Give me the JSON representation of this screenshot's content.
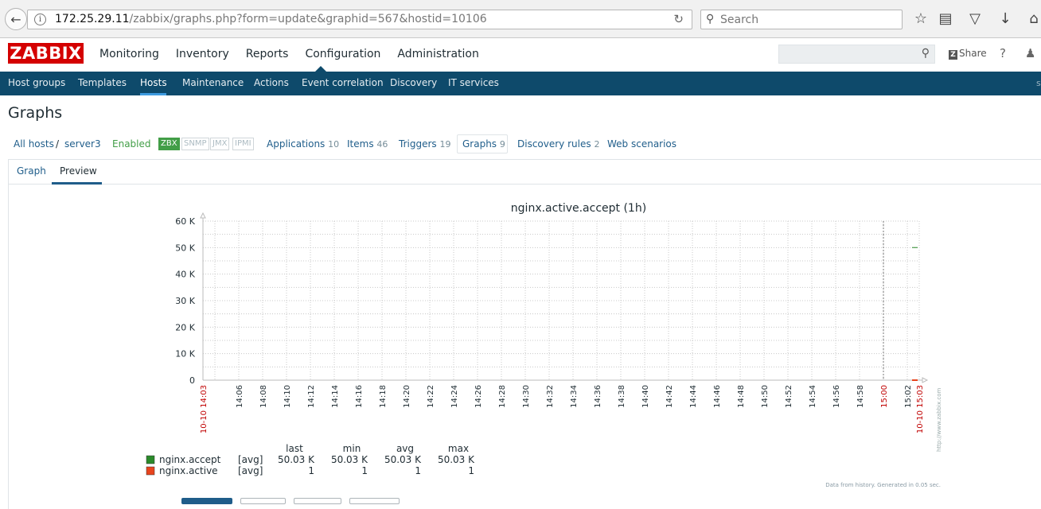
{
  "browser": {
    "url_host": "172.25.29.11",
    "url_path": "/zabbix/graphs.php?form=update&graphid=567&hostid=10106",
    "search_placeholder": "Search"
  },
  "header": {
    "logo": "ZABBIX",
    "menu": [
      "Monitoring",
      "Inventory",
      "Reports",
      "Configuration",
      "Administration"
    ],
    "active_menu": "Configuration",
    "share_label": "Share",
    "help_label": "?"
  },
  "submenu": {
    "items": [
      "Host groups",
      "Templates",
      "Hosts",
      "Maintenance",
      "Actions",
      "Event correlation",
      "Discovery",
      "IT services"
    ],
    "active": "Hosts",
    "edge_text": "s"
  },
  "page": {
    "title": "Graphs"
  },
  "breadcrumbs": {
    "all_hosts": "All hosts",
    "separator": "/",
    "host": "server3",
    "status": "Enabled",
    "interfaces": [
      "ZBX",
      "SNMP",
      "JMX",
      "IPMI"
    ],
    "applications": {
      "label": "Applications",
      "count": "10"
    },
    "items": {
      "label": "Items",
      "count": "46"
    },
    "triggers": {
      "label": "Triggers",
      "count": "19"
    },
    "graphs": {
      "label": "Graphs",
      "count": "9"
    },
    "discovery": {
      "label": "Discovery rules",
      "count": "2"
    },
    "web": {
      "label": "Web scenarios"
    }
  },
  "tabs": {
    "graph": "Graph",
    "preview": "Preview"
  },
  "chart_data": {
    "type": "line",
    "title": "nginx.active.accept (1h)",
    "y_ticks": [
      "0",
      "10 K",
      "20 K",
      "30 K",
      "40 K",
      "50 K",
      "60 K"
    ],
    "ylim": [
      0,
      60000
    ],
    "x_start_label": "10-10 14:03",
    "x_end_label": "10-10 15:03",
    "x_ticks": [
      "14:06",
      "14:08",
      "14:10",
      "14:12",
      "14:14",
      "14:16",
      "14:18",
      "14:20",
      "14:22",
      "14:24",
      "14:26",
      "14:28",
      "14:30",
      "14:32",
      "14:34",
      "14:36",
      "14:38",
      "14:40",
      "14:42",
      "14:44",
      "14:46",
      "14:48",
      "14:50",
      "14:52",
      "14:54",
      "14:56",
      "14:58",
      "15:00",
      "15:02"
    ],
    "x_highlight": "15:00",
    "series": [
      {
        "name": "nginx.accept",
        "func": "[avg]",
        "color": "#2a8a2a",
        "last": "50.03 K",
        "min": "50.03 K",
        "avg": "50.03 K",
        "max": "50.03 K",
        "value": 50030,
        "x_from": "15:02",
        "x_to": "15:03"
      },
      {
        "name": "nginx.active",
        "func": "[avg]",
        "color": "#e8441d",
        "last": "1",
        "min": "1",
        "avg": "1",
        "max": "1",
        "value": 1,
        "x_from": "15:02",
        "x_to": "15:03"
      }
    ],
    "legend_headers": [
      "last",
      "min",
      "avg",
      "max"
    ],
    "watermark": "http://www.zabbix.com",
    "footer_note": "Data from history. Generated in 0.05 sec."
  },
  "colors": {
    "brand_red": "#d40000",
    "submenu_bg": "#0e4a6b",
    "link": "#1f5d8a",
    "enabled_green": "#429e47",
    "highlight_red": "#c00000"
  }
}
